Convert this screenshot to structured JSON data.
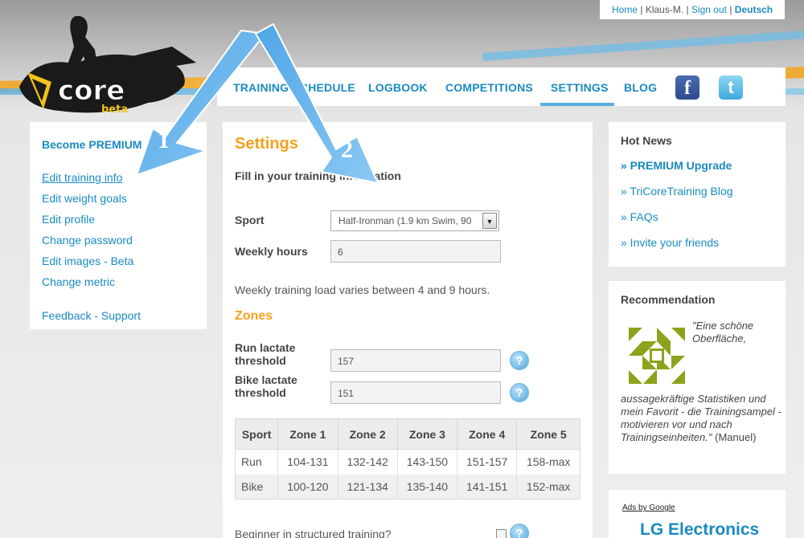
{
  "toplinks": {
    "home": "Home",
    "user": "Klaus-M.",
    "signout": "Sign out",
    "lang": "Deutsch"
  },
  "logo": {
    "text": "core",
    "badge": "beta"
  },
  "nav": {
    "items": [
      "TRAINING SCHEDULE",
      "LOGBOOK",
      "COMPETITIONS",
      "SETTINGS",
      "BLOG"
    ],
    "active": "SETTINGS",
    "facebook_glyph": "f",
    "twitter_glyph": "t"
  },
  "sidebar": {
    "title": "Become PREMIUM",
    "items": [
      "Edit training info",
      "Edit weight goals",
      "Edit profile",
      "Change password",
      "Edit images - Beta",
      "Change metric"
    ],
    "feedback": "Feedback - Support"
  },
  "main": {
    "title": "Settings",
    "subtitle": "Fill in your training information",
    "sport_label": "Sport",
    "sport_value": "Half-Ironman (1.9 km Swim, 90",
    "weekly_label": "Weekly hours",
    "weekly_value": "6",
    "note": "Weekly training load varies between 4 and 9 hours.",
    "zones_title": "Zones",
    "run_label": "Run lactate threshold",
    "run_value": "157",
    "bike_label": "Bike lactate threshold",
    "bike_value": "151",
    "help_glyph": "?",
    "table": {
      "headers": [
        "Sport",
        "Zone 1",
        "Zone 2",
        "Zone 3",
        "Zone 4",
        "Zone 5"
      ],
      "rows": [
        [
          "Run",
          "104-131",
          "132-142",
          "143-150",
          "151-157",
          "158-max"
        ],
        [
          "Bike",
          "100-120",
          "121-134",
          "135-140",
          "141-151",
          "152-max"
        ]
      ]
    },
    "beginner_label": "Beginner in structured training?"
  },
  "hotnews": {
    "title": "Hot News",
    "items": [
      "» PREMIUM Upgrade",
      "» TriCoreTraining Blog",
      "» FAQs",
      "» Invite your friends"
    ]
  },
  "recommendation": {
    "title": "Recommendation",
    "quote_a": "\"Eine schöne Oberfläche,",
    "quote_b": "aussagekräftige Statistiken und mein Favorit - die Trainingsampel - motivieren vor und nach Trainingseinheiten.\"",
    "author": "(Manuel)"
  },
  "ads": {
    "label": "Ads by Google",
    "headline": "LG Electronics"
  },
  "annotations": {
    "label_1": "1",
    "label_2": "2"
  },
  "colors": {
    "accent_blue": "#1a8ac2",
    "accent_orange": "#f3a11d",
    "arrow_blue": "#64b4ec"
  }
}
